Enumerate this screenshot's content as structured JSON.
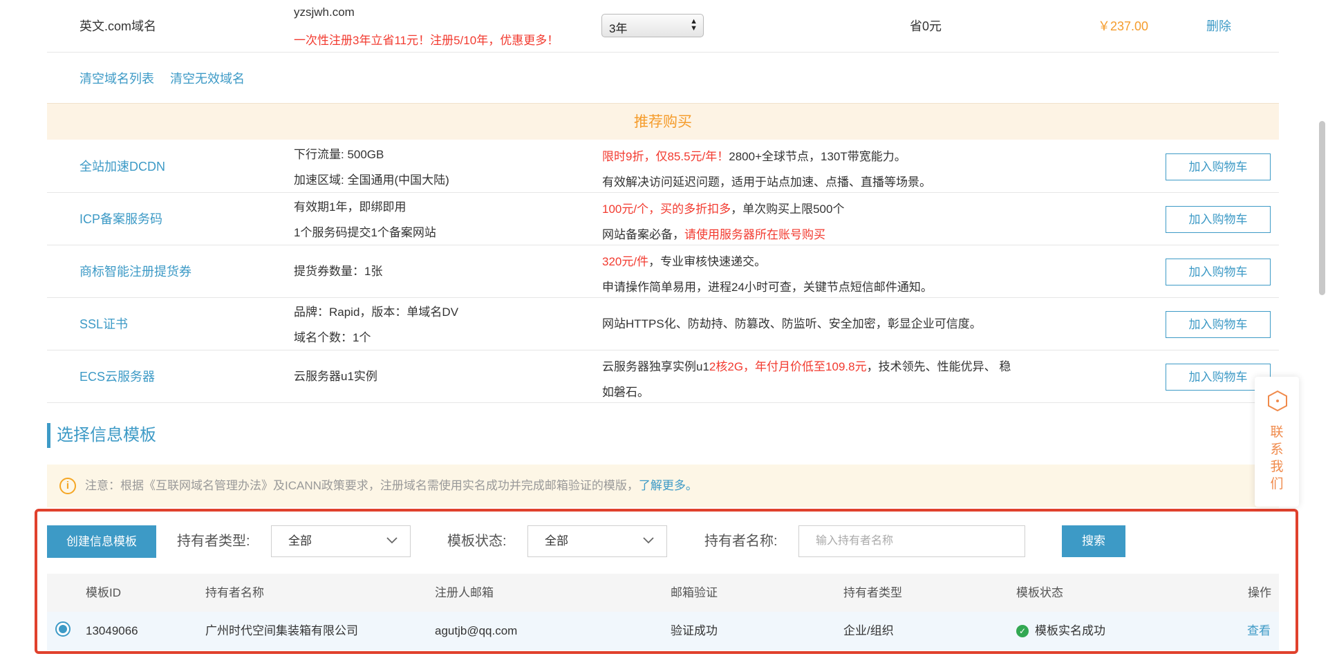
{
  "top_row": {
    "name": "英文.com域名",
    "domain": "yzsjwh.com",
    "promo": "一次性注册3年立省11元！注册5/10年，优惠更多！",
    "years": "3年",
    "saving": "省0元",
    "price": "￥237.00",
    "delete": "删除"
  },
  "clear_links": {
    "clear_list": "清空域名列表",
    "clear_invalid": "清空无效域名"
  },
  "recommend": {
    "title": "推荐购买",
    "cart_label": "加入购物车",
    "items": [
      {
        "name": "全站加速DCDN",
        "spec1": "下行流量: 500GB",
        "spec2": "加速区域: 全国通用(中国大陆)",
        "desc1_red": "限时9折，仅85.5元/年！",
        "desc1": "2800+全球节点，130T带宽能力。",
        "desc2": "有效解决访问延迟问题，适用于站点加速、点播、直播等场景。"
      },
      {
        "name": "ICP备案服务码",
        "spec1": "有效期1年，即绑即用",
        "spec2": "1个服务码提交1个备案网站",
        "desc1_red": "100元/个，买的多折扣多",
        "desc1": "，单次购买上限500个",
        "desc2": "网站备案必备，",
        "desc2_red": "请使用服务器所在账号购买"
      },
      {
        "name": "商标智能注册提货券",
        "spec1": "提货券数量：1张",
        "desc1_red": "320元/件",
        "desc1": "，专业审核快速递交。",
        "desc2": "申请操作简单易用，进程24小时可查，关键节点短信邮件通知。"
      },
      {
        "name": "SSL证书",
        "spec1": "品牌：Rapid，版本：单域名DV",
        "spec2": "域名个数：1个",
        "desc1": "网站HTTPS化、防劫持、防篡改、防监听、安全加密，彰显企业可信度。"
      },
      {
        "name": "ECS云服务器",
        "spec1": "云服务器u1实例",
        "desc1a": "云服务器独享实例u1",
        "desc1_red": "2核2G，年付月价低至109.8元",
        "desc1": "，技术领先、性能优异、 稳",
        "desc2": "如磐石。"
      }
    ]
  },
  "section_title": "选择信息模板",
  "notice": {
    "text": "注意：根据《互联网域名管理办法》及ICANN政策要求，注册域名需使用实名成功并完成邮箱验证的模版，",
    "link": "了解更多。"
  },
  "filters": {
    "create_button": "创建信息模板",
    "holder_type_label": "持有者类型:",
    "holder_type_value": "全部",
    "status_label": "模板状态:",
    "status_value": "全部",
    "holder_name_label": "持有者名称:",
    "holder_name_placeholder": "输入持有者名称",
    "search_button": "搜索"
  },
  "table": {
    "headers": [
      "模板ID",
      "持有者名称",
      "注册人邮箱",
      "邮箱验证",
      "持有者类型",
      "模板状态",
      "操作"
    ],
    "rows": [
      {
        "id": "13049066",
        "holder_name": "广州时代空间集装箱有限公司",
        "email": "agutjb@qq.com",
        "email_verify": "验证成功",
        "holder_type": "企业/组织",
        "status": "模板实名成功",
        "action": "查看"
      }
    ]
  },
  "contact": {
    "label_chars": [
      "联",
      "系",
      "我",
      "们"
    ]
  },
  "colors": {
    "accent": "#3d9ac6",
    "promo_red": "#f23a2f",
    "price_orange": "#f59c2c",
    "highlight_border": "#e0412d"
  }
}
